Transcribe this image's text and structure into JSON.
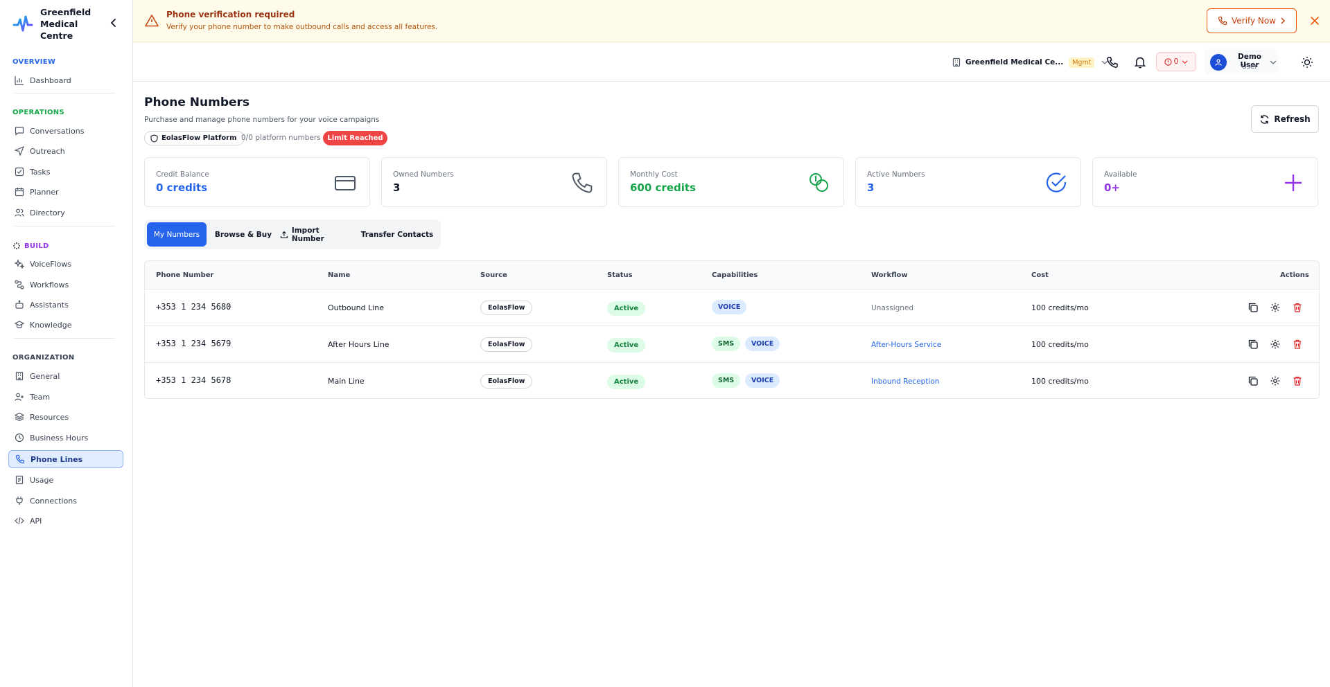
{
  "brand": {
    "name": "Greenfield Medical Centre"
  },
  "sidebar": {
    "sections": [
      {
        "title": "OVERVIEW",
        "color": "#2563eb",
        "items": [
          {
            "label": "Dashboard",
            "icon": "bar-chart-icon"
          }
        ]
      },
      {
        "title": "OPERATIONS",
        "color": "#16a34a",
        "items": [
          {
            "label": "Conversations",
            "icon": "chat-icon"
          },
          {
            "label": "Outreach",
            "icon": "send-icon"
          },
          {
            "label": "Tasks",
            "icon": "checkbox-icon"
          },
          {
            "label": "Planner",
            "icon": "calendar-icon"
          },
          {
            "label": "Directory",
            "icon": "users-icon"
          }
        ]
      },
      {
        "title": "BUILD",
        "color": "#9333ea",
        "items": [
          {
            "label": "VoiceFlows",
            "icon": "sparkle-icon"
          },
          {
            "label": "Workflows",
            "icon": "workflow-icon"
          },
          {
            "label": "Assistants",
            "icon": "bot-icon"
          },
          {
            "label": "Knowledge",
            "icon": "graduation-cap-icon"
          }
        ]
      },
      {
        "title": "ORGANIZATION",
        "color": "#374151",
        "items": [
          {
            "label": "General",
            "icon": "building-icon"
          },
          {
            "label": "Team",
            "icon": "user-plus-icon"
          },
          {
            "label": "Resources",
            "icon": "layers-icon"
          },
          {
            "label": "Business Hours",
            "icon": "clock-icon"
          },
          {
            "label": "Phone Lines",
            "icon": "phone-icon",
            "active": true
          },
          {
            "label": "Usage",
            "icon": "receipt-icon"
          },
          {
            "label": "Connections",
            "icon": "plug-icon"
          },
          {
            "label": "API",
            "icon": "code-icon"
          }
        ]
      }
    ]
  },
  "banner": {
    "title": "Phone verification required",
    "text": "Verify your phone number to make outbound calls and access all features.",
    "button": "Verify Now"
  },
  "topbar": {
    "org_name": "Greenfield Medical Ce...",
    "org_tag": "Mgmt",
    "alert_count": "0",
    "user_name": "Demo User",
    "user_role": "User"
  },
  "page": {
    "title": "Phone Numbers",
    "subtitle": "Purchase and manage phone numbers for your voice campaigns",
    "platform_badge": "EolasFlow Platform",
    "platform_count": "0/0 platform numbers",
    "limit_badge": "Limit Reached",
    "refresh": "Refresh"
  },
  "stats": [
    {
      "label": "Credit Balance",
      "value": "0 credits",
      "color": "#2563eb",
      "icon": "credit-card-icon"
    },
    {
      "label": "Owned Numbers",
      "value": "3",
      "color": "#111827",
      "icon": "phone-icon"
    },
    {
      "label": "Monthly Cost",
      "value": "600 credits",
      "color": "#16a34a",
      "icon": "coins-icon"
    },
    {
      "label": "Active Numbers",
      "value": "3",
      "color": "#2563eb",
      "icon": "check-circle-icon"
    },
    {
      "label": "Available",
      "value": "0+",
      "color": "#9333ea",
      "icon": "plus-icon"
    }
  ],
  "tabs": [
    "My Numbers",
    "Browse & Buy",
    "Import Number",
    "Transfer Contacts"
  ],
  "table": {
    "headers": [
      "Phone Number",
      "Name",
      "Source",
      "Status",
      "Capabilities",
      "Workflow",
      "Cost",
      "Actions"
    ],
    "rows": [
      {
        "number": "+353 1 234 5680",
        "name": "Outbound Line",
        "source": "EolasFlow",
        "status": "Active",
        "caps": [
          "VOICE"
        ],
        "workflow": "Unassigned",
        "cost": "100 credits/mo"
      },
      {
        "number": "+353 1 234 5679",
        "name": "After Hours Line",
        "source": "EolasFlow",
        "status": "Active",
        "caps": [
          "SMS",
          "VOICE"
        ],
        "workflow": "After-Hours Service",
        "cost": "100 credits/mo"
      },
      {
        "number": "+353 1 234 5678",
        "name": "Main Line",
        "source": "EolasFlow",
        "status": "Active",
        "caps": [
          "SMS",
          "VOICE"
        ],
        "workflow": "Inbound Reception",
        "cost": "100 credits/mo"
      }
    ]
  }
}
